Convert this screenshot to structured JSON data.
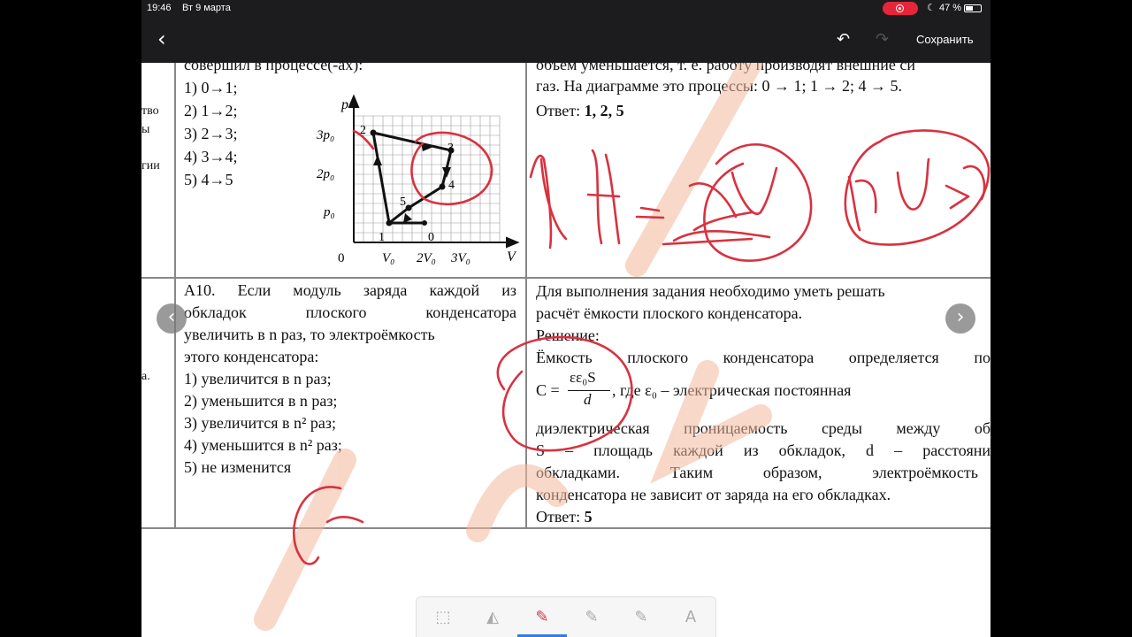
{
  "status": {
    "time": "19:46",
    "date": "Вт 9 марта",
    "battery": "47 %"
  },
  "toolbar": {
    "save_label": "Сохранить"
  },
  "left_fragments": [
    "тво",
    "ы",
    "гии",
    "а."
  ],
  "q9": {
    "line0": "совершил в процессе(-ах):",
    "options": [
      "1) 0→1;",
      "2) 1→2;",
      "3) 2→3;",
      "4) 3→4;",
      "5) 4→5"
    ],
    "graph": {
      "axis_p": "p",
      "axis_v": "V",
      "p_ticks": [
        "3p₀",
        "2p₀",
        "p₀"
      ],
      "v_ticks": [
        "0",
        "V₀",
        "2V₀",
        "3V₀"
      ],
      "points": [
        "2",
        "3",
        "4",
        "5",
        "1",
        "0"
      ]
    }
  },
  "a9": {
    "line0": "объем уменьшается, т. е. работу производят внешние си",
    "line1": "газ. На диаграмме это процессы:  0 → 1;  1 → 2;  4 → 5.",
    "answer_label": "Ответ:",
    "answer_value": "1, 2, 5"
  },
  "q10": {
    "lines": [
      "А10. Если модуль заряда каждой из",
      "обкладок плоского конденсатора",
      "увеличить в n раз, то электроёмкость",
      "этого конденсатора:"
    ],
    "options": [
      "1) увеличится в n раз;",
      "2) уменьшится в n раз;",
      "3) увеличится в n² раз;",
      "4) уменьшится в n² раз;",
      "5) не изменится"
    ]
  },
  "a10": {
    "intro": [
      "Для выполнения задания необходимо уметь решать",
      "расчёт ёмкости плоского конденсатора."
    ],
    "solution_label": "Решение:",
    "line_cap": "Ёмкость плоского конденсатора определяется по",
    "formula_lhs": "C =",
    "formula_num": "εε₀S",
    "formula_den": "d",
    "formula_tail": ",  где        ε₀ – электрическая          постоянная",
    "body": [
      "диэлектрическая проницаемость среды между об",
      "S – площадь каждой из обкладок, d – расстояни",
      "обкладками. Таким образом, электроёмкость",
      "конденсатора не зависит от заряда на его обкладках."
    ],
    "answer_label": "Ответ:",
    "answer_value": "5"
  },
  "colors": {
    "ink": "#d8323f",
    "watermark": "#f3b89a",
    "record": "#e5263a"
  }
}
